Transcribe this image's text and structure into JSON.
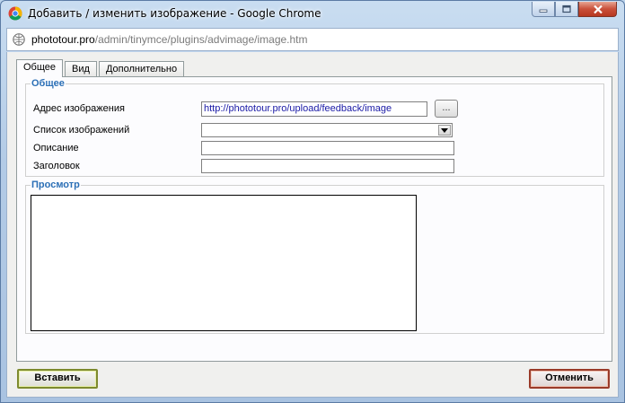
{
  "window": {
    "title": "Добавить / изменить изображение - Google Chrome"
  },
  "address_bar": {
    "host": "phototour.pro",
    "path": "/admin/tinymce/plugins/advimage/image.htm"
  },
  "tabs": [
    {
      "label": "Общее",
      "active": true
    },
    {
      "label": "Вид",
      "active": false
    },
    {
      "label": "Дополнительно",
      "active": false
    }
  ],
  "general": {
    "legend": "Общее",
    "image_url_label": "Адрес изображения",
    "image_url_value": "http://phototour.pro/upload/feedback/image",
    "browse_label": "...",
    "image_list_label": "Список изображений",
    "image_list_value": "",
    "description_label": "Описание",
    "description_value": "",
    "title_label": "Заголовок",
    "title_value": ""
  },
  "preview": {
    "legend": "Просмотр"
  },
  "buttons": {
    "insert": "Вставить",
    "cancel": "Отменить"
  },
  "icons": {
    "browser": "chrome-icon",
    "page": "page-icon",
    "minimize": "minimize-icon",
    "maximize": "maximize-icon",
    "close": "close-icon",
    "dropdown": "chevron-down-icon"
  }
}
